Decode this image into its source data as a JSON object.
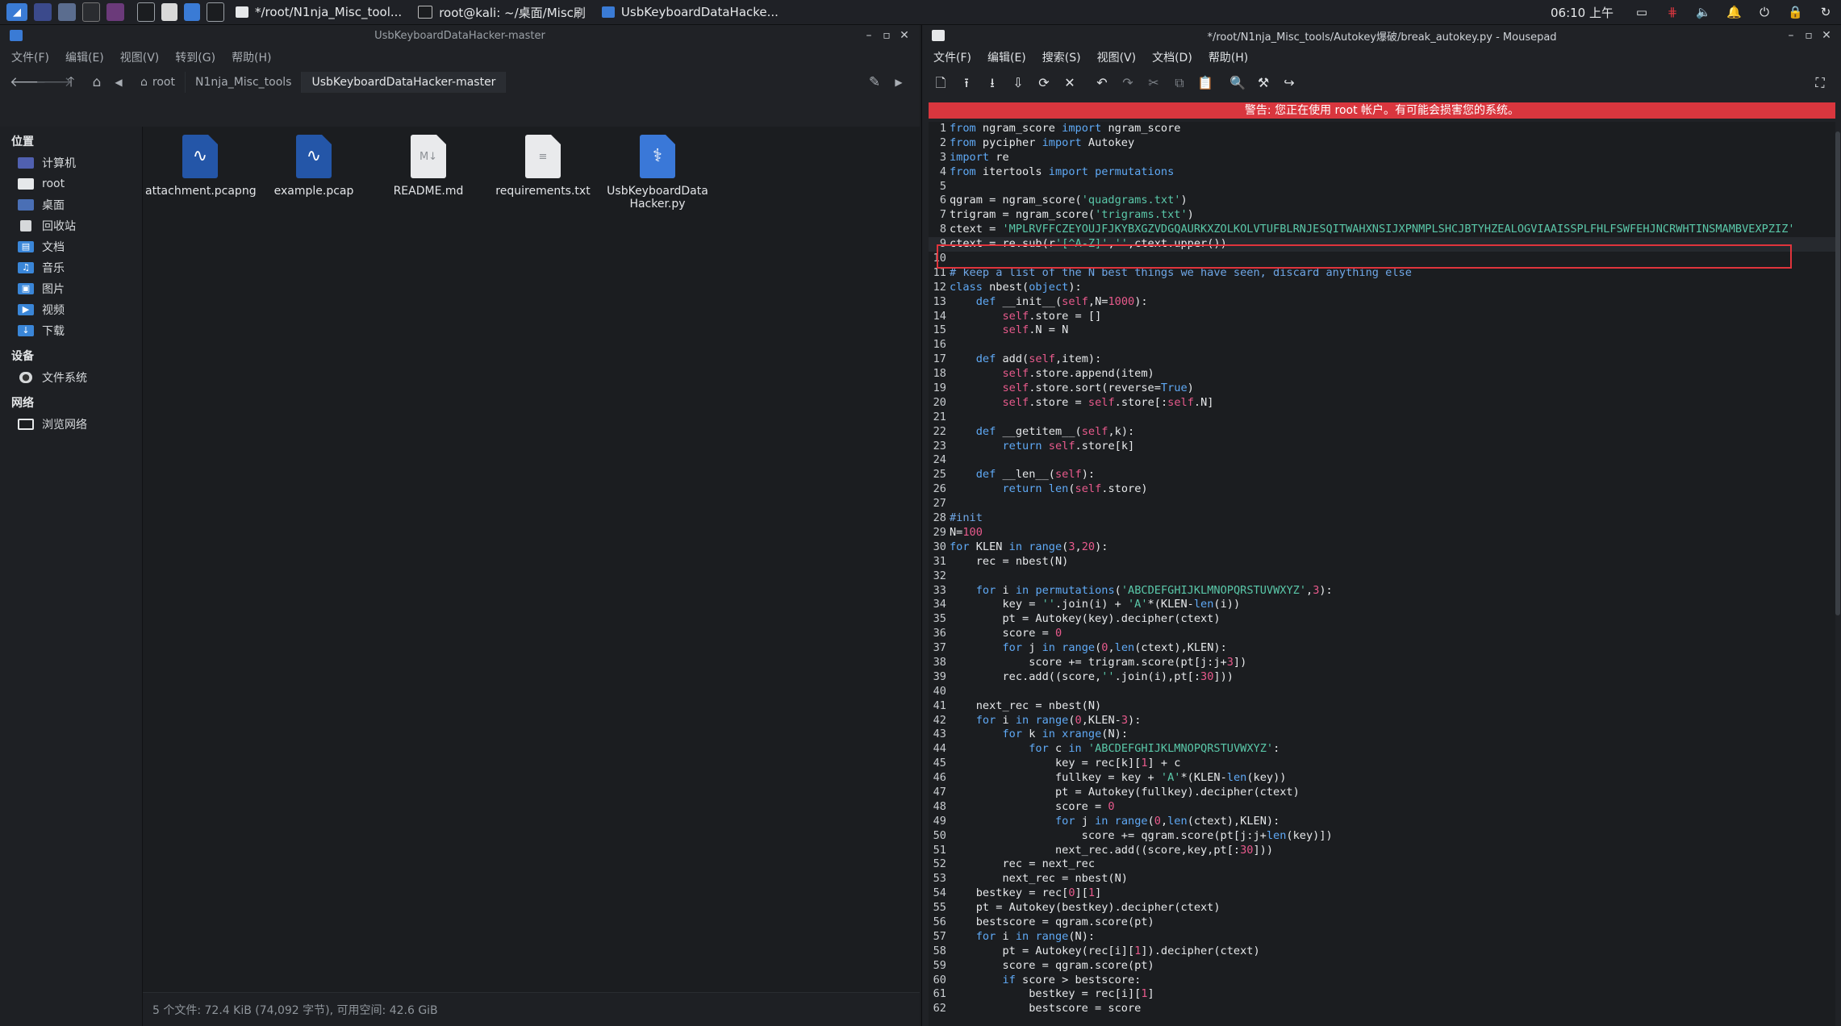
{
  "panel": {
    "tasks": [
      {
        "label": "*/root/N1nja_Misc_tool..."
      },
      {
        "label": "root@kali: ~/桌面/Misc刷"
      },
      {
        "label": "UsbKeyboardDataHacke..."
      }
    ],
    "clock": "06:10 上午"
  },
  "fm": {
    "title": "UsbKeyboardDataHacker-master",
    "menu": [
      "文件(F)",
      "编辑(E)",
      "视图(V)",
      "转到(G)",
      "帮助(H)"
    ],
    "breadcrumbs": [
      "root",
      "N1nja_Misc_tools",
      "UsbKeyboardDataHacker-master"
    ],
    "sidebar": {
      "places_title": "位置",
      "places": [
        "计算机",
        "root",
        "桌面",
        "回收站",
        "文档",
        "音乐",
        "图片",
        "视频",
        "下载"
      ],
      "devices_title": "设备",
      "devices": [
        "文件系统"
      ],
      "network_title": "网络",
      "network": [
        "浏览网络"
      ]
    },
    "files": [
      {
        "name": "attachment.pcapng",
        "kind": "pcap"
      },
      {
        "name": "example.pcap",
        "kind": "pcap"
      },
      {
        "name": "README.md",
        "kind": "md"
      },
      {
        "name": "requirements.txt",
        "kind": "txt"
      },
      {
        "name": "UsbKeyboardDataHacker.py",
        "kind": "py"
      }
    ],
    "status": "5 个文件: 72.4 KiB (74,092 字节), 可用空间: 42.6 GiB"
  },
  "editor": {
    "title": "*/root/N1nja_Misc_tools/Autokey爆破/break_autokey.py - Mousepad",
    "menu": [
      "文件(F)",
      "编辑(E)",
      "搜索(S)",
      "视图(V)",
      "文档(D)",
      "帮助(H)"
    ],
    "warning": "警告: 您正在使用 root 帐户。有可能会损害您的系统。",
    "lines": [
      "from ngram_score import ngram_score",
      "from pycipher import Autokey",
      "import re",
      "from itertools import permutations",
      "",
      "qgram = ngram_score('quadgrams.txt')",
      "trigram = ngram_score('trigrams.txt')",
      "ctext = 'MPLRVFFCZEYOUJFJKYBXGZVDGQAURKXZOLKOLVTUFBLRNJESQITWAHXNSIJXPNMPLSHCJBTYHZEALOGVIAAISSPLFHLFSWFEHJNCRWHTINSMAMBVEXPZIZ'",
      "ctext = re.sub(r'[^A-Z]','',ctext.upper())",
      "",
      "# keep a list of the N best things we have seen, discard anything else",
      "class nbest(object):",
      "    def __init__(self,N=1000):",
      "        self.store = []",
      "        self.N = N",
      "",
      "    def add(self,item):",
      "        self.store.append(item)",
      "        self.store.sort(reverse=True)",
      "        self.store = self.store[:self.N]",
      "",
      "    def __getitem__(self,k):",
      "        return self.store[k]",
      "",
      "    def __len__(self):",
      "        return len(self.store)",
      "",
      "#init",
      "N=100",
      "for KLEN in range(3,20):",
      "    rec = nbest(N)",
      "",
      "    for i in permutations('ABCDEFGHIJKLMNOPQRSTUVWXYZ',3):",
      "        key = ''.join(i) + 'A'*(KLEN-len(i))",
      "        pt = Autokey(key).decipher(ctext)",
      "        score = 0",
      "        for j in range(0,len(ctext),KLEN):",
      "            score += trigram.score(pt[j:j+3])",
      "        rec.add((score,''.join(i),pt[:30]))",
      "",
      "    next_rec = nbest(N)",
      "    for i in range(0,KLEN-3):",
      "        for k in xrange(N):",
      "            for c in 'ABCDEFGHIJKLMNOPQRSTUVWXYZ':",
      "                key = rec[k][1] + c",
      "                fullkey = key + 'A'*(KLEN-len(key))",
      "                pt = Autokey(fullkey).decipher(ctext)",
      "                score = 0",
      "                for j in range(0,len(ctext),KLEN):",
      "                    score += qgram.score(pt[j:j+len(key)])",
      "                next_rec.add((score,key,pt[:30]))",
      "        rec = next_rec",
      "        next_rec = nbest(N)",
      "    bestkey = rec[0][1]",
      "    pt = Autokey(bestkey).decipher(ctext)",
      "    bestscore = qgram.score(pt)",
      "    for i in range(N):",
      "        pt = Autokey(rec[i][1]).decipher(ctext)",
      "        score = qgram.score(pt)",
      "        if score > bestscore:",
      "            bestkey = rec[i][1]",
      "            bestscore = score"
    ],
    "current_line": 9
  }
}
